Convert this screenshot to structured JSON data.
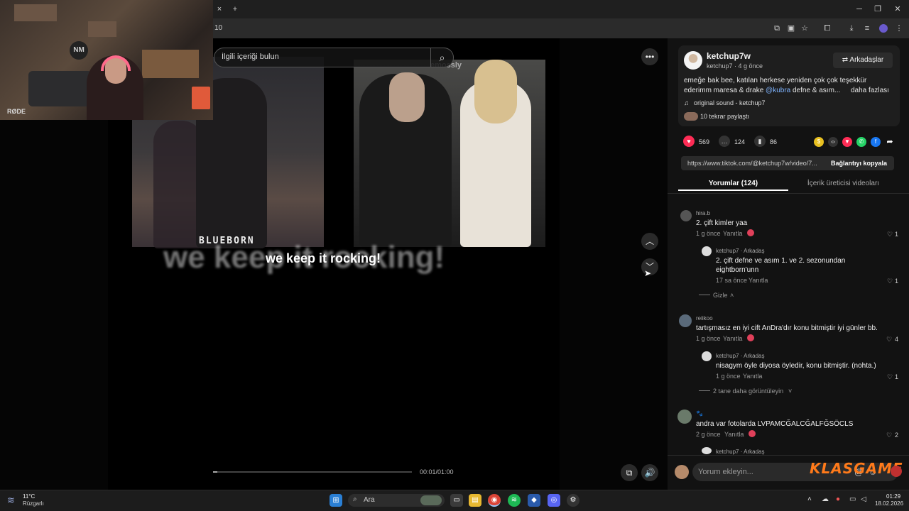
{
  "browser": {
    "address_text": "10",
    "tab_close": "×",
    "tab_new": "+",
    "win_min": "─",
    "win_max": "❐",
    "win_close": "✕"
  },
  "webcam": {
    "mic_brand": "RØDE",
    "logo_text": "NM"
  },
  "video": {
    "search_placeholder": "İlgili içeriği bulun",
    "watermark": "emossly",
    "overlay_label": "BLUEBORN",
    "big_caption": "we keep it rocking!",
    "small_caption": "we keep it rocking!",
    "time": "00:01/01:00",
    "progress_fraction": 0.02
  },
  "post": {
    "username": "ketchup7w",
    "subline": "ketchup7 · 4 g önce",
    "friends_button": "⇄ Arkadaşlar",
    "caption_line1": "emeğe bak bee, katılan herkese yeniden çok çok teşekkür",
    "caption_line2_a": "ederimm maresa & drake ",
    "caption_mention": "@kubra",
    "caption_line2_b": " defne & asım...",
    "more": "daha fazlası",
    "sound": "original sound - ketchup7",
    "reposts": "10 tekrar paylaştı",
    "likes": "569",
    "comments": "124",
    "saves": "86",
    "link_url": "https://www.tiktok.com/@ketchup7w/video/7...",
    "copy_link": "Bağlantıyı kopyala",
    "tab_comments": "Yorumlar (124)",
    "tab_videos": "İçerik üreticisi videoları"
  },
  "comments": [
    {
      "name": "hira.b",
      "text": "2. çift kimler yaa",
      "time": "1 g önce",
      "reply": "Yanıtla",
      "likes": "1"
    },
    {
      "name": "ketchup7 · Arkadaş",
      "text1": "2. çift defne ve asım 1. ve 2. sezonundan",
      "text2": "eightborn'unn",
      "time": "17 sa önce",
      "reply": "Yanıtla",
      "likes": "1"
    },
    {
      "name": "reiikoo",
      "text": "tartışmasız en iyi cift AnDra'dır konu bitmiştir iyi günler bb.",
      "time": "1 g önce",
      "reply": "Yanıtla",
      "likes": "4"
    },
    {
      "name": "ketchup7 · Arkadaş",
      "text": "nisagym öyle diyosa öyledir, konu bitmiştir. (nohta.)",
      "time": "1 g önce",
      "reply": "Yanıtla",
      "likes": "1"
    },
    {
      "name": "🐾",
      "text": "andra var fotolarda LVPAMCĞALCĞALFĞSÖCLS",
      "time": "2 g önce",
      "reply": "Yanıtla",
      "likes": "2"
    },
    {
      "name": "ketchup7 · Arkadaş"
    }
  ],
  "thread": {
    "hide": "Gizle",
    "more_replies": "2 tane daha görüntüleyin"
  },
  "composer": {
    "placeholder": "Yorum ekleyin...",
    "brand": "KLASGAME"
  },
  "taskbar": {
    "weather_temp": "11°C",
    "weather_desc": "Rüzgarlı",
    "search": "Ara",
    "time": "01:29",
    "date": "18.02.2026"
  },
  "colors": {
    "like": "#fe2c55",
    "panel": "#121212",
    "brand": "#ff7a1a"
  }
}
